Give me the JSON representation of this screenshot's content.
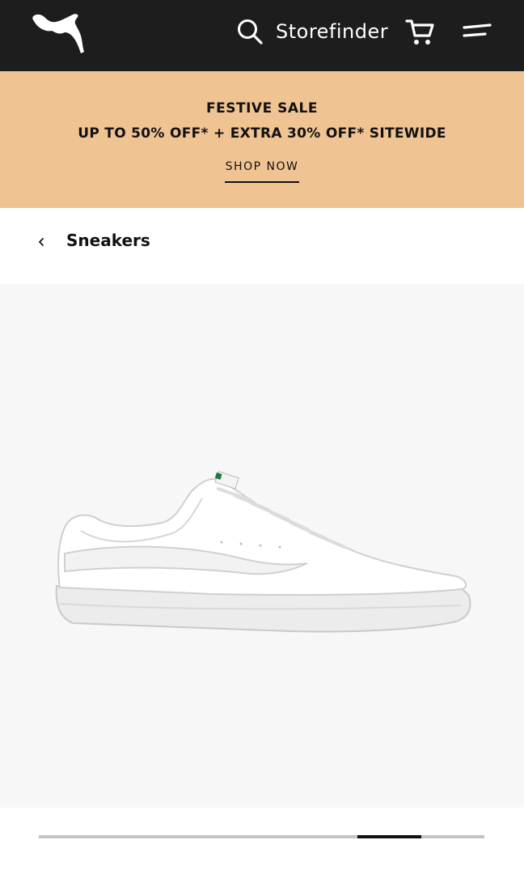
{
  "header": {
    "logo": "puma-cat-logo",
    "search_icon": "search-icon",
    "storefinder_label": "Storefinder",
    "cart_icon": "cart-icon",
    "menu_icon": "menu-icon"
  },
  "promo": {
    "title": "FESTIVE SALE",
    "subtitle": "UP TO 50% OFF* + EXTRA 30% OFF* SITEWIDE",
    "cta_label": "SHOP NOW"
  },
  "breadcrumb": {
    "back_icon": "chevron-left-icon",
    "label": "Sneakers"
  },
  "product": {
    "image": "white-leather-sneaker"
  },
  "carousel": {
    "current_index": 5,
    "total": 7
  },
  "colors": {
    "header_bg": "#1d1d1d",
    "promo_bg": "#efc392",
    "image_bg": "#f7f7f7"
  }
}
